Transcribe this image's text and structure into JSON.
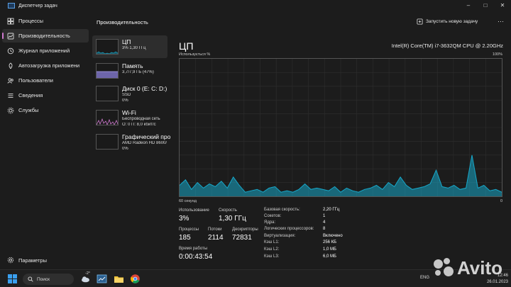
{
  "window": {
    "title": "Диспетчер задач"
  },
  "nav": {
    "items": [
      {
        "label": "Процессы"
      },
      {
        "label": "Производительность"
      },
      {
        "label": "Журнал приложений"
      },
      {
        "label": "Автозагрузка приложени"
      },
      {
        "label": "Пользователи"
      },
      {
        "label": "Сведения"
      },
      {
        "label": "Службы"
      }
    ],
    "settings": "Параметры"
  },
  "header": {
    "title": "Производительность",
    "new_task": "Запустить новую задачу"
  },
  "devices": [
    {
      "name": "ЦП",
      "line1": "3% 1,30 ГГц",
      "line2": ""
    },
    {
      "name": "Память",
      "line1": "3,7/7,9 ГБ (47%)",
      "line2": ""
    },
    {
      "name": "Диск 0 (E: C: D:)",
      "line1": "SSD",
      "line2": "0%"
    },
    {
      "name": "Wi-Fi",
      "line1": "Беспроводная сеть",
      "line2": "О: 0 П: 8,0 кбит/с"
    },
    {
      "name": "Графический про",
      "line1": "AMD Radeon HD 8600/",
      "line2": "0%"
    }
  ],
  "cpu": {
    "title": "ЦП",
    "model": "Intel(R) Core(TM) i7-3632QM CPU @ 2.20GHz",
    "graph_label": "Использується %",
    "graph_max": "100%",
    "graph_time": "60 секунд",
    "graph_min": "0",
    "usage_label": "Использование",
    "usage": "3%",
    "speed_label": "Скорость",
    "speed": "1,30 ГГц",
    "proc_label": "Процессы",
    "proc": "185",
    "threads_label": "Потоки",
    "threads": "2114",
    "handles_label": "Дескрипторы",
    "handles": "72831",
    "uptime_label": "Время работы",
    "uptime": "0:00:43:54",
    "specs": [
      {
        "k": "Базовая скорость:",
        "v": "2,20 ГГц"
      },
      {
        "k": "Сокетов:",
        "v": "1"
      },
      {
        "k": "Ядра:",
        "v": "4"
      },
      {
        "k": "Логических процессоров:",
        "v": "8"
      },
      {
        "k": "Виртуализация:",
        "v": "Включено"
      },
      {
        "k": "Кэш L1:",
        "v": "256 КБ"
      },
      {
        "k": "Кэш L2:",
        "v": "1,0 МБ"
      },
      {
        "k": "Кэш L3:",
        "v": "6,0 МБ"
      }
    ],
    "history": [
      8,
      12,
      5,
      10,
      6,
      9,
      7,
      11,
      6,
      14,
      8,
      3,
      4,
      5,
      3,
      6,
      7,
      3,
      4,
      3,
      5,
      9,
      5,
      6,
      5,
      4,
      7,
      3,
      6,
      4,
      3,
      5,
      6,
      8,
      5,
      10,
      7,
      14,
      8,
      5,
      6,
      7,
      9,
      19,
      7,
      6,
      8,
      5,
      6,
      30,
      6,
      8,
      4,
      5,
      3
    ]
  },
  "taskbar": {
    "search": "Поиск",
    "lang": "ENG",
    "time": "12:46",
    "date": "26.01.2023",
    "weather": "-2°"
  },
  "watermark": "Avito",
  "colors": {
    "accent": "#17a7c9",
    "highlight": "#d07ad0"
  }
}
